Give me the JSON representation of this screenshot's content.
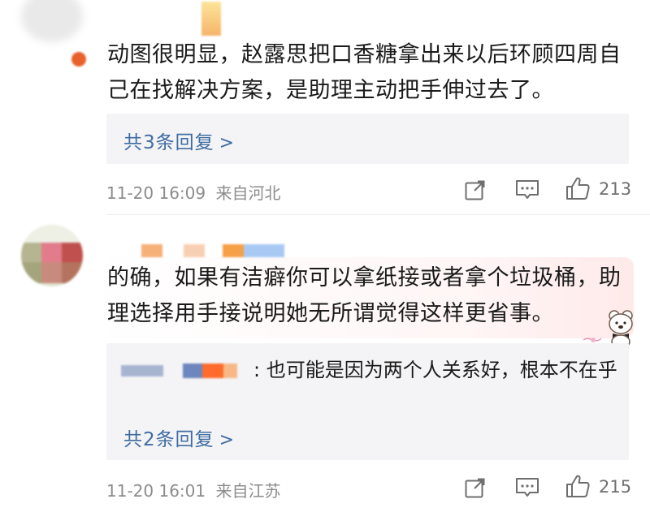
{
  "comments": [
    {
      "text": "动图很明显，赵露思把口香糖拿出来以后环顾四周自己在找解决方案，是助理主动把手伸过去了。",
      "replies_link": "共3条回复",
      "chevron": ">",
      "timestamp": "11-20 16:09",
      "location": "来自河北",
      "likes": "213",
      "icons": [
        "share-icon",
        "comment-icon",
        "like-icon"
      ]
    },
    {
      "text": "的确，如果有洁癖你可以拿纸接或者拿个垃圾桶，助理选择用手接说明她无所谓觉得这样更省事。",
      "sub_reply_text": ": 也可能是因为两个人关系好，根本不在乎",
      "replies_link": "共2条回复",
      "chevron": ">",
      "timestamp": "11-20 16:01",
      "location": "来自江苏",
      "likes": "215",
      "icons": [
        "share-icon",
        "comment-icon",
        "like-icon"
      ]
    }
  ],
  "colors": {
    "link": "#3f6ca3",
    "meta": "#8c8c8c",
    "reply_bg": "#f4f4f6"
  }
}
